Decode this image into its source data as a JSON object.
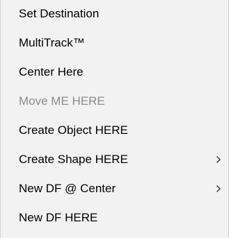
{
  "menu": {
    "items": [
      {
        "label": "Set Destination",
        "enabled": true,
        "submenu": false
      },
      {
        "label": "MultiTrack™",
        "enabled": true,
        "submenu": false
      },
      {
        "label": "Center Here",
        "enabled": true,
        "submenu": false
      },
      {
        "label": "Move ME HERE",
        "enabled": false,
        "submenu": false
      },
      {
        "label": "Create Object HERE",
        "enabled": true,
        "submenu": false
      },
      {
        "label": "Create Shape HERE",
        "enabled": true,
        "submenu": true
      },
      {
        "label": "New DF @ Center",
        "enabled": true,
        "submenu": true
      },
      {
        "label": "New DF HERE",
        "enabled": true,
        "submenu": false
      }
    ]
  },
  "colors": {
    "background": "#f2f2f2",
    "text": "#000000",
    "disabled_text": "#8a8a8a",
    "border": "#cfcfcf"
  },
  "icons": {
    "submenu": "chevron-right-icon"
  }
}
